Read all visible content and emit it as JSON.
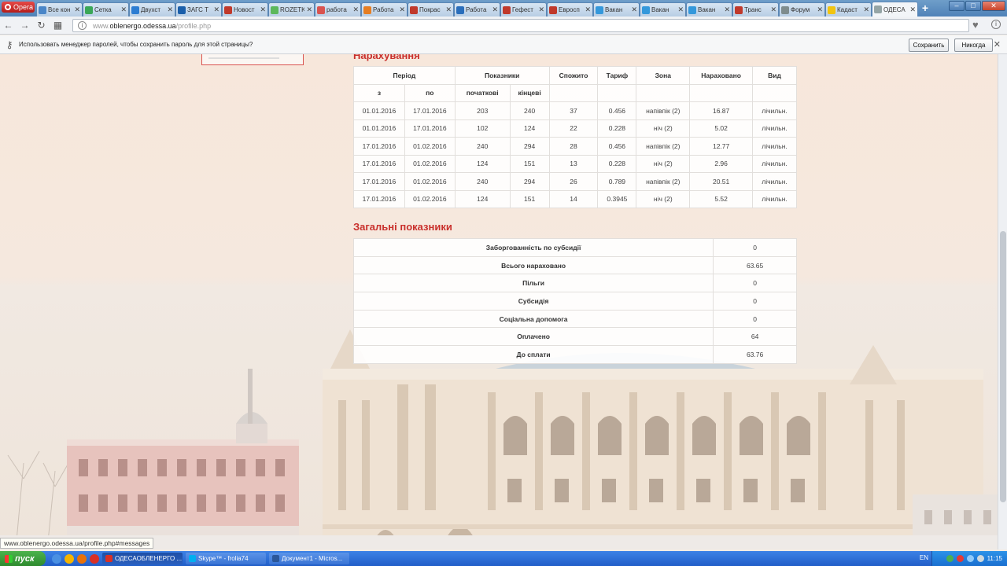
{
  "browser": {
    "opera_label": "Opera",
    "tabs": [
      {
        "title": "Все кон",
        "color": "#4a86c8"
      },
      {
        "title": "Сетка",
        "color": "#3aa757"
      },
      {
        "title": "Двухст",
        "color": "#2d7dd2"
      },
      {
        "title": "ЗАГС Т",
        "color": "#1b5faa"
      },
      {
        "title": "Новост",
        "color": "#c0392b"
      },
      {
        "title": "ROZETK",
        "color": "#5cb85c"
      },
      {
        "title": "работа",
        "color": "#d9534f"
      },
      {
        "title": "Работа",
        "color": "#e67e22"
      },
      {
        "title": "Покрас",
        "color": "#c0392b"
      },
      {
        "title": "Работа",
        "color": "#2a6ebb"
      },
      {
        "title": "Гефест",
        "color": "#c0392b"
      },
      {
        "title": "Евросп",
        "color": "#c0392b"
      },
      {
        "title": "Вакан",
        "color": "#3498db"
      },
      {
        "title": "Вакан",
        "color": "#3498db"
      },
      {
        "title": "Вакан",
        "color": "#3498db"
      },
      {
        "title": "Транс",
        "color": "#c0392b"
      },
      {
        "title": "Форум",
        "color": "#7f8c8d"
      },
      {
        "title": "Кадаст",
        "color": "#f1c40f"
      },
      {
        "title": "ОДЕСА",
        "color": "#95a5a6",
        "active": true
      }
    ],
    "url_prefix": "www.",
    "url_domain": "oblenergo.odessa.ua",
    "url_path": "/profile.php",
    "password_prompt": "Использовать менеджер паролей, чтобы сохранить пароль для этой страницы?",
    "save_label": "Сохранить",
    "never_label": "Никогда"
  },
  "charges": {
    "title": "Нарахування",
    "headers": {
      "period": "Період",
      "readings": "Показники",
      "consumed": "Спожито",
      "tariff": "Тариф",
      "zone": "Зона",
      "charged": "Нараховано",
      "type": "Вид",
      "from": "з",
      "to": "по",
      "initial": "початкові",
      "final": "кінцеві"
    },
    "rows": [
      [
        "01.01.2016",
        "17.01.2016",
        "203",
        "240",
        "37",
        "0.456",
        "напівпік (2)",
        "16.87",
        "лічильн."
      ],
      [
        "01.01.2016",
        "17.01.2016",
        "102",
        "124",
        "22",
        "0.228",
        "ніч (2)",
        "5.02",
        "лічильн."
      ],
      [
        "17.01.2016",
        "01.02.2016",
        "240",
        "294",
        "28",
        "0.456",
        "напівпік (2)",
        "12.77",
        "лічильн."
      ],
      [
        "17.01.2016",
        "01.02.2016",
        "124",
        "151",
        "13",
        "0.228",
        "ніч (2)",
        "2.96",
        "лічильн."
      ],
      [
        "17.01.2016",
        "01.02.2016",
        "240",
        "294",
        "26",
        "0.789",
        "напівпік (2)",
        "20.51",
        "лічильн."
      ],
      [
        "17.01.2016",
        "01.02.2016",
        "124",
        "151",
        "14",
        "0.3945",
        "ніч (2)",
        "5.52",
        "лічильн."
      ]
    ]
  },
  "totals": {
    "title": "Загальні показники",
    "rows": [
      {
        "label": "Заборгованність по субсидії",
        "value": "0"
      },
      {
        "label": "Всього нараховано",
        "value": "63.65"
      },
      {
        "label": "Пільги",
        "value": "0"
      },
      {
        "label": "Субсидія",
        "value": "0"
      },
      {
        "label": "Соціальна допомога",
        "value": "0"
      },
      {
        "label": "Оплачено",
        "value": "64"
      },
      {
        "label": "До сплати",
        "value": "63.76"
      }
    ]
  },
  "status_link": "www.oblenergo.odessa.ua/profile.php#messages",
  "taskbar": {
    "start_label": "пуск",
    "tasks": [
      {
        "label": "ОДЕСАОБЛЕНЕРГО ...",
        "active": true
      },
      {
        "label": "Skype™ - frolia74",
        "active": false
      },
      {
        "label": "Документ1 - Micros...",
        "active": false
      }
    ],
    "lang": "EN",
    "clock": "11:15"
  },
  "colors": {
    "accent_red": "#c9302c",
    "taskbar_blue": "#2a6cd6"
  }
}
